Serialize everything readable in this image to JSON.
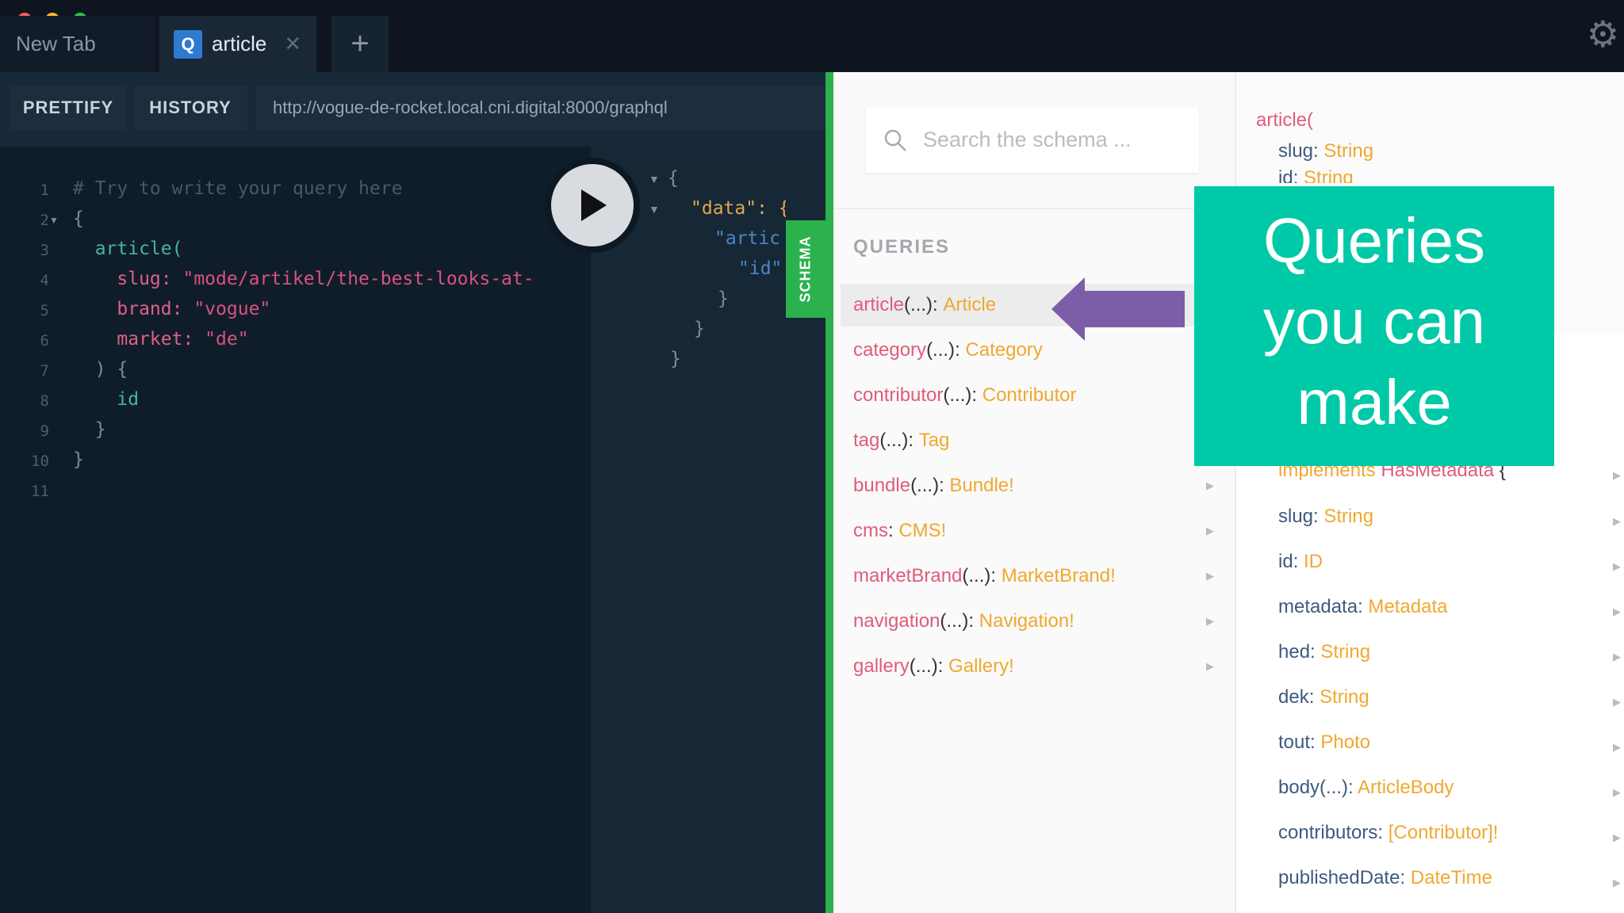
{
  "window": {
    "controls": {
      "close": "#ff5f57",
      "minimize": "#febc2e",
      "maximize": "#28c840"
    }
  },
  "tabs": [
    {
      "label": "New Tab"
    },
    {
      "badge": "Q",
      "label": "article",
      "close": "✕"
    }
  ],
  "new_tab_icon": "+",
  "settings_icon": "gear-icon",
  "toolbar": {
    "prettify": "PRETTIFY",
    "history": "HISTORY",
    "url": "http://vogue-de-rocket.local.cni.digital:8000/graphql"
  },
  "editor": {
    "lines": [
      {
        "n": "1",
        "text": "# Try to write your query here",
        "color": "#4a5866"
      },
      {
        "n": "2",
        "text": "{",
        "color": "#7f8c98"
      },
      {
        "n": "3",
        "text": "  article(",
        "color": "#47b39a"
      },
      {
        "n": "4",
        "key": "    slug: ",
        "value": "\"mode/artikel/the-best-looks-at-"
      },
      {
        "n": "5",
        "key": "    brand: ",
        "value": "\"vogue\""
      },
      {
        "n": "6",
        "key": "    market: ",
        "value": "\"de\""
      },
      {
        "n": "7",
        "text": "  ) {",
        "color": "#7f8c98"
      },
      {
        "n": "8",
        "text": "    id",
        "color": "#47b39a"
      },
      {
        "n": "9",
        "text": "  }",
        "color": "#7f8c98"
      },
      {
        "n": "10",
        "text": "}",
        "color": "#7f8c98"
      },
      {
        "n": "11",
        "text": "",
        "color": "#7f8c98"
      }
    ]
  },
  "results": {
    "lines": [
      "{",
      "\"data\": {",
      "\"artic",
      "\"id\"",
      "}",
      "}",
      "}"
    ]
  },
  "schema_tab": "SCHEMA",
  "explorer": {
    "search_placeholder": "Search the schema ...",
    "section": "QUERIES",
    "items": [
      {
        "name": "article",
        "args": "(...)",
        "type": "Article"
      },
      {
        "name": "category",
        "args": "(...)",
        "type": "Category"
      },
      {
        "name": "contributor",
        "args": "(...)",
        "type": "Contributor"
      },
      {
        "name": "tag",
        "args": "(...)",
        "type": "Tag"
      },
      {
        "name": "bundle",
        "args": "(...)",
        "type": "Bundle!"
      },
      {
        "name": "cms",
        "args": "",
        "type": "CMS!"
      },
      {
        "name": "marketBrand",
        "args": "(...)",
        "type": "MarketBrand!"
      },
      {
        "name": "navigation",
        "args": "(...)",
        "type": "Navigation!"
      },
      {
        "name": "gallery",
        "args": "(...)",
        "type": "Gallery!"
      }
    ]
  },
  "detail": {
    "head": "article(",
    "args": [
      {
        "name": "slug",
        "type": "String"
      },
      {
        "name": "id",
        "type": "String"
      }
    ],
    "implements": "implements",
    "interface": "HasMetadata",
    "brace": "{",
    "fields": [
      {
        "name": "slug",
        "type": "String"
      },
      {
        "name": "id",
        "type": "ID"
      },
      {
        "name": "metadata",
        "type": "Metadata"
      },
      {
        "name": "hed",
        "type": "String"
      },
      {
        "name": "dek",
        "type": "String"
      },
      {
        "name": "tout",
        "type": "Photo"
      },
      {
        "name": "body(...)",
        "type": "ArticleBody"
      },
      {
        "name": "contributors",
        "type": "[Contributor]!"
      },
      {
        "name": "publishedDate",
        "type": "DateTime"
      }
    ]
  },
  "callout": {
    "text": [
      "Queries",
      "you can",
      "make"
    ],
    "color": "#00c9a7",
    "arrow_color": "#7b5ea7"
  }
}
